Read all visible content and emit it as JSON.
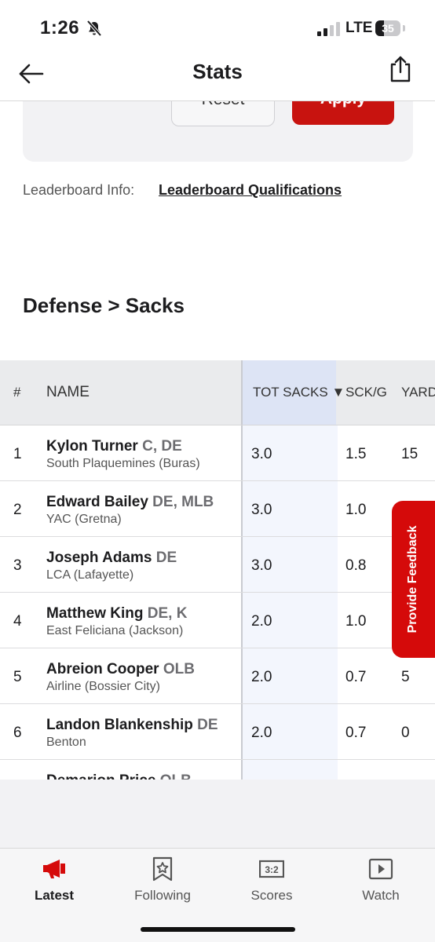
{
  "status_bar": {
    "time": "1:26",
    "network": "LTE",
    "battery": "35",
    "battery_level": 0.35
  },
  "header": {
    "title": "Stats"
  },
  "filter": {
    "reset_label": "Reset",
    "apply_label": "Apply"
  },
  "leaderboard_info": {
    "label": "Leaderboard Info:",
    "link": "Leaderboard Qualifications"
  },
  "section_title": "Defense > Sacks",
  "table": {
    "headers": {
      "rank": "#",
      "name": "NAME",
      "tot_sacks": "TOT SACKS ▼",
      "sck_g": "SCK/G",
      "yards": "YARD"
    },
    "rows": [
      {
        "rank": "1",
        "name": "Kylon Turner",
        "pos": "C, DE",
        "school": "South Plaquemines (Buras)",
        "tot": "3.0",
        "sckg": "1.5",
        "yards": "15"
      },
      {
        "rank": "2",
        "name": "Edward Bailey",
        "pos": "DE, MLB",
        "school": "YAC (Gretna)",
        "tot": "3.0",
        "sckg": "1.0",
        "yards": ""
      },
      {
        "rank": "3",
        "name": "Joseph Adams",
        "pos": "DE",
        "school": "LCA (Lafayette)",
        "tot": "3.0",
        "sckg": "0.8",
        "yards": ""
      },
      {
        "rank": "4",
        "name": "Matthew King",
        "pos": "DE, K",
        "school": "East Feliciana (Jackson)",
        "tot": "2.0",
        "sckg": "1.0",
        "yards": ""
      },
      {
        "rank": "5",
        "name": "Abreion Cooper",
        "pos": "OLB",
        "school": "Airline (Bossier City)",
        "tot": "2.0",
        "sckg": "0.7",
        "yards": "5"
      },
      {
        "rank": "6",
        "name": "Landon Blankenship",
        "pos": "DE",
        "school": "Benton",
        "tot": "2.0",
        "sckg": "0.7",
        "yards": "0"
      },
      {
        "rank": "",
        "name": "Demarion Price",
        "pos": "OLB",
        "school": "",
        "tot": "",
        "sckg": "",
        "yards": ""
      }
    ]
  },
  "feedback_tab": "Provide Feedback",
  "tab_bar": {
    "tabs": [
      {
        "label": "Latest",
        "icon": "megaphone-icon",
        "active": true
      },
      {
        "label": "Following",
        "icon": "bookmark-star-icon",
        "active": false
      },
      {
        "label": "Scores",
        "icon": "scoreboard-icon",
        "active": false
      },
      {
        "label": "Watch",
        "icon": "play-icon",
        "active": false
      }
    ],
    "active_color": "#d50a0a",
    "score_icon_text": "3:2"
  }
}
